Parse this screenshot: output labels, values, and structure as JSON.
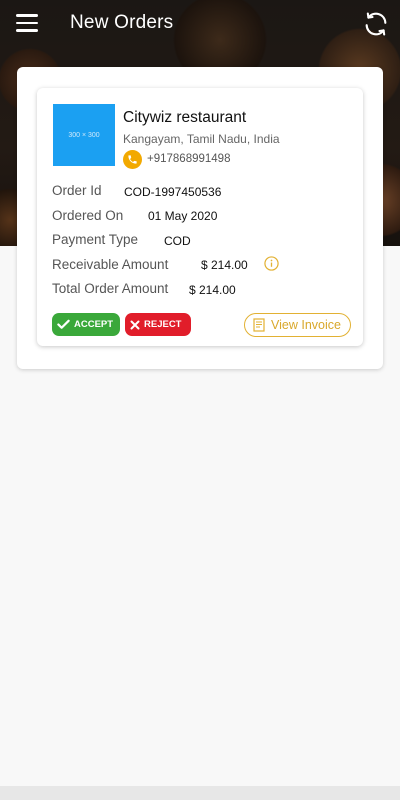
{
  "header": {
    "title": "New Orders",
    "menu_icon": "hamburger-menu-icon",
    "refresh_icon": "refresh-icon"
  },
  "order": {
    "image_placeholder": "300 × 300",
    "restaurant_name": "Citywiz restaurant",
    "location": "Kangayam, Tamil Nadu, India",
    "phone": "+917868991498",
    "fields": {
      "order_id_label": "Order Id",
      "order_id_value": "COD-1997450536",
      "ordered_on_label": "Ordered On",
      "ordered_on_value": "01 May 2020",
      "payment_type_label": "Payment Type",
      "payment_type_value": "COD",
      "receivable_amount_label": "Receivable Amount",
      "receivable_amount_value": "$ 214.00",
      "total_order_amount_label": "Total Order Amount",
      "total_order_amount_value": "$ 214.00"
    },
    "actions": {
      "accept_label": "ACCEPT",
      "reject_label": "REJECT",
      "view_invoice_label": "View Invoice"
    }
  },
  "colors": {
    "accent": "#f2a900",
    "accept": "#3aa83a",
    "reject": "#e11d2a",
    "placeholder": "#1ba0f2"
  }
}
